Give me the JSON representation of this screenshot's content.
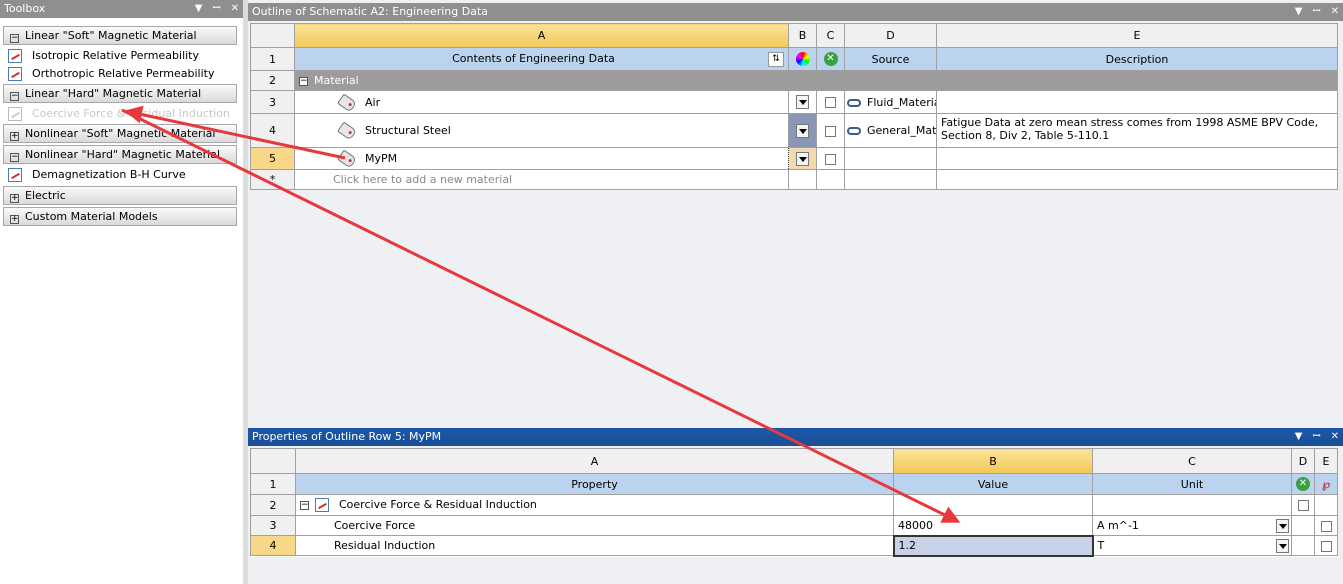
{
  "toolbox": {
    "title": "Toolbox",
    "controls": [
      "▼",
      "📌",
      "✕"
    ],
    "categories": [
      {
        "label": "Linear \"Soft\" Magnetic Material",
        "expanded": true
      },
      {
        "label": "Linear \"Hard\" Magnetic Material",
        "expanded": true
      },
      {
        "label": "Nonlinear \"Soft\" Magnetic Material",
        "expanded": false
      },
      {
        "label": "Nonlinear \"Hard\" Magnetic Material",
        "expanded": true
      },
      {
        "label": "Electric",
        "expanded": false
      },
      {
        "label": "Custom Material Models",
        "expanded": false
      }
    ],
    "items": [
      {
        "label": "Isotropic Relative Permeability"
      },
      {
        "label": "Orthotropic Relative Permeability"
      },
      {
        "label": "Coercive Force & Residual Induction"
      },
      {
        "label": "Demagnetization B-H Curve"
      }
    ]
  },
  "outline": {
    "title": "Outline of Schematic A2: Engineering Data",
    "col_letters": [
      "A",
      "B",
      "C",
      "D",
      "E"
    ],
    "row_numbers": [
      "1",
      "2",
      "3",
      "4",
      "5",
      "*"
    ],
    "headers": {
      "contents": "Contents of Engineering Data",
      "source": "Source",
      "description": "Description"
    },
    "group": "Material",
    "rows": [
      {
        "name": "Air",
        "source": "Fluid_Materia",
        "description": ""
      },
      {
        "name": "Structural Steel",
        "source": "General_Mate",
        "description": "Fatigue Data at zero mean stress comes from 1998 ASME BPV Code, Section 8, Div 2, Table 5-110.1"
      },
      {
        "name": "MyPM",
        "source": "",
        "description": ""
      }
    ],
    "add_hint": "Click here to add a new material"
  },
  "properties": {
    "title": "Properties of Outline Row 5: MyPM",
    "col_letters": [
      "A",
      "B",
      "C",
      "D",
      "E"
    ],
    "row_numbers": [
      "1",
      "2",
      "3",
      "4"
    ],
    "headers": {
      "property": "Property",
      "value": "Value",
      "unit": "Unit"
    },
    "group": "Coercive Force & Residual Induction",
    "rows": [
      {
        "property": "Coercive Force",
        "value": "48000",
        "unit": "A m^-1"
      },
      {
        "property": "Residual Induction",
        "value": "1.2",
        "unit": "T"
      }
    ]
  },
  "colors": {
    "title_active": "#1c57a8",
    "arrow": "#e8383d",
    "group_row": "#9c9c9c",
    "header_blue": "#bcd3f0",
    "selected_header": "#f3c856"
  }
}
